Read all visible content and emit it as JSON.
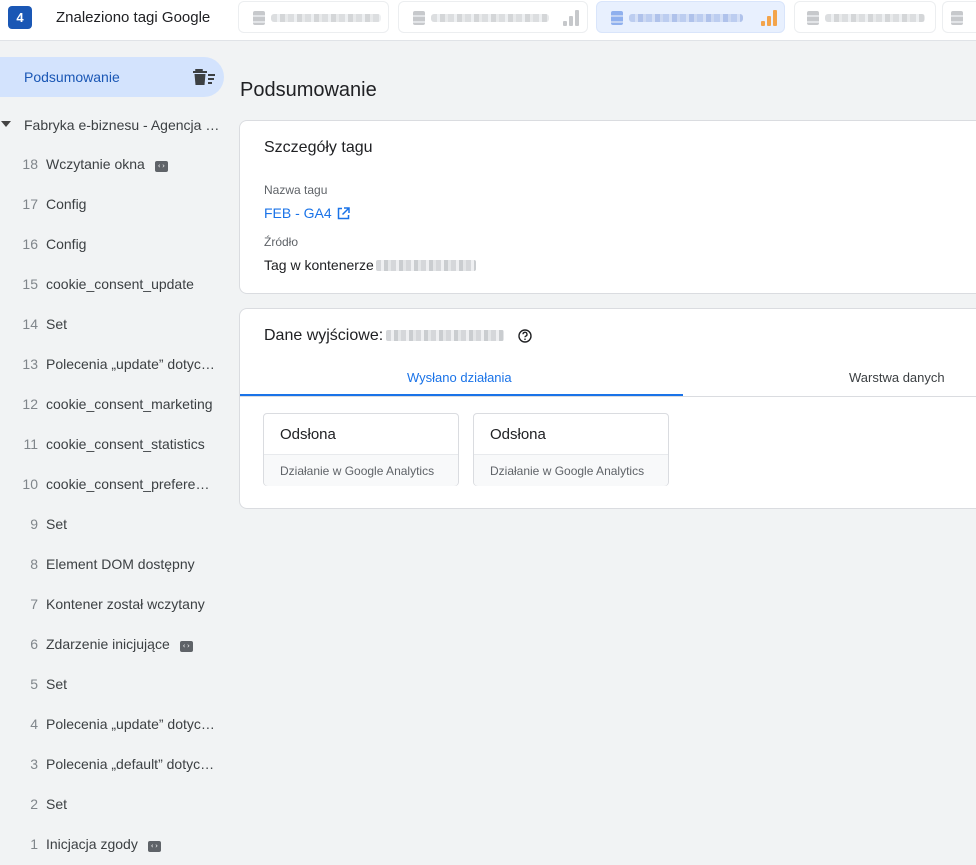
{
  "topbar": {
    "count_badge": "4",
    "title": "Znaleziono tagi Google"
  },
  "sidebar": {
    "summary_label": "Podsumowanie",
    "container_label": "Fabryka e-biznesu - Agencja Marketingowa",
    "events": [
      {
        "num": "18",
        "label": "Wczytanie okna",
        "code_icon": true
      },
      {
        "num": "17",
        "label": "Config",
        "code_icon": false
      },
      {
        "num": "16",
        "label": "Config",
        "code_icon": false
      },
      {
        "num": "15",
        "label": "cookie_consent_update",
        "code_icon": false
      },
      {
        "num": "14",
        "label": "Set",
        "code_icon": false
      },
      {
        "num": "13",
        "label": "Polecenia „update” dotyczące zgody",
        "code_icon": false
      },
      {
        "num": "12",
        "label": "cookie_consent_marketing",
        "code_icon": false
      },
      {
        "num": "11",
        "label": "cookie_consent_statistics",
        "code_icon": false
      },
      {
        "num": "10",
        "label": "cookie_consent_preferences",
        "code_icon": false
      },
      {
        "num": "9",
        "label": "Set",
        "code_icon": false
      },
      {
        "num": "8",
        "label": "Element DOM dostępny",
        "code_icon": false
      },
      {
        "num": "7",
        "label": "Kontener został wczytany",
        "code_icon": false
      },
      {
        "num": "6",
        "label": "Zdarzenie inicjujące",
        "code_icon": true
      },
      {
        "num": "5",
        "label": "Set",
        "code_icon": false
      },
      {
        "num": "4",
        "label": "Polecenia „update” dotyczące zgody",
        "code_icon": false
      },
      {
        "num": "3",
        "label": "Polecenia „default” dotyczące zgody",
        "code_icon": false
      },
      {
        "num": "2",
        "label": "Set",
        "code_icon": false
      },
      {
        "num": "1",
        "label": "Inicjacja zgody",
        "code_icon": true
      }
    ]
  },
  "main": {
    "page_title": "Podsumowanie",
    "tag_details": {
      "title": "Szczegóły tagu",
      "name_label": "Nazwa tagu",
      "name_value": "FEB - GA4",
      "source_label": "Źródło",
      "source_value": "Tag w kontenerze"
    },
    "output": {
      "title": "Dane wyjściowe:",
      "tabs": [
        "Wysłano działania",
        "Warstwa danych"
      ],
      "actions": [
        {
          "title": "Odsłona",
          "subtitle": "Działanie w Google Analytics"
        },
        {
          "title": "Odsłona",
          "subtitle": "Działanie w Google Analytics"
        }
      ]
    }
  },
  "colors": {
    "accent": "#1a73e8",
    "badge": "#1a57b5",
    "selected_bg": "#d3e3fd",
    "page_bg": "#f1f3f4"
  }
}
